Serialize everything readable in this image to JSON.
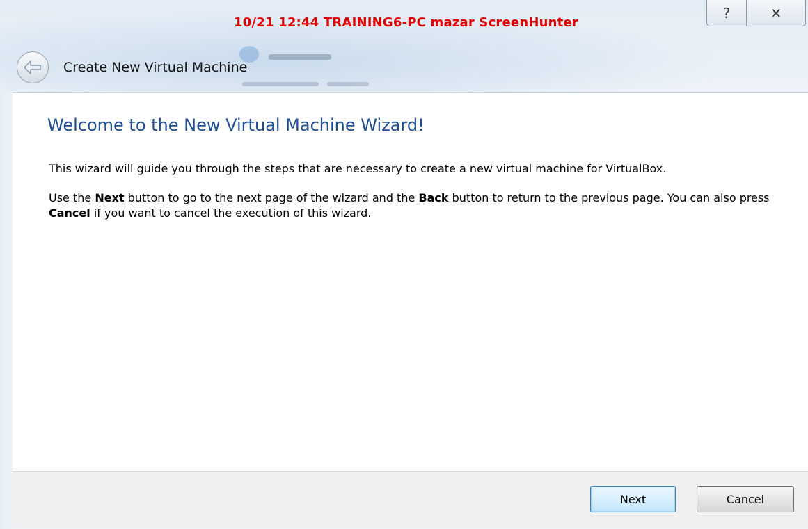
{
  "watermark": "10/21 12:44 TRAINING6-PC mazar ScreenHunter",
  "window": {
    "title": "Create New Virtual Machine",
    "help_glyph": "?",
    "close_glyph": "✕"
  },
  "page": {
    "heading": "Welcome to the New Virtual Machine Wizard!",
    "intro": "This wizard will guide you through the steps that are necessary to create a new virtual machine for VirtualBox.",
    "nav_text": {
      "part1": "Use the ",
      "next_word": "Next",
      "part2": " button to go to the next page of the wizard and the ",
      "back_word": "Back",
      "part3": " button to return to the previous page. You can also press ",
      "cancel_word": "Cancel",
      "part4": " if you want to cancel the execution of this wizard."
    }
  },
  "buttons": {
    "next": "Next",
    "cancel": "Cancel"
  },
  "icons": {
    "back": "back-arrow-icon",
    "help": "help-icon",
    "close": "close-icon"
  },
  "colors": {
    "heading": "#1e4d93",
    "watermark": "#e00000",
    "footer_bg": "#f0f0f0"
  }
}
